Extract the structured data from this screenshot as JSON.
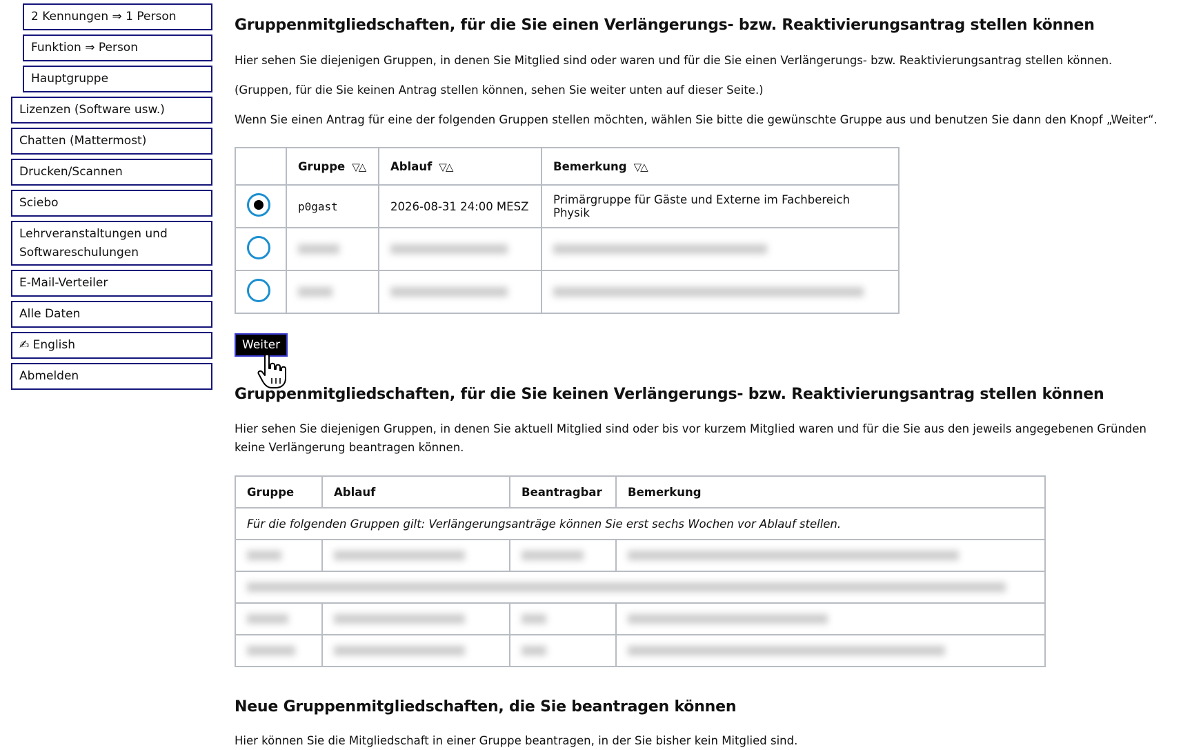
{
  "sidebar": {
    "sub_items": [
      {
        "label": "2 Kennungen ⇒ 1 Person"
      },
      {
        "label": "Funktion ⇒ Person"
      },
      {
        "label": "Hauptgruppe"
      }
    ],
    "items": [
      {
        "label": "Lizenzen (Software usw.)"
      },
      {
        "label": "Chatten (Mattermost)"
      },
      {
        "label": "Drucken/Scannen"
      },
      {
        "label": "Sciebo"
      },
      {
        "label": "Lehrveranstaltungen und Softwareschulungen"
      },
      {
        "label": "E-Mail-Verteiler"
      },
      {
        "label": "Alle Daten"
      },
      {
        "label": "✍ English"
      },
      {
        "label": "Abmelden"
      }
    ]
  },
  "section1": {
    "heading": "Gruppenmitgliedschaften, für die Sie einen Verlängerungs- bzw. Reaktivierungsantrag stellen können",
    "para1": "Hier sehen Sie diejenigen Gruppen, in denen Sie Mitglied sind oder waren und für die Sie einen Verlängerungs- bzw. Reaktivierungsantrag stellen können.",
    "para2": "(Gruppen, für die Sie keinen Antrag stellen können, sehen Sie weiter unten auf dieser Seite.)",
    "para3": "Wenn Sie einen Antrag für eine der folgenden Gruppen stellen möchten, wählen Sie bitte die gewünschte Gruppe aus und benutzen Sie dann den Knopf „Weiter“.",
    "table": {
      "headers": {
        "gruppe": "Gruppe",
        "ablauf": "Ablauf",
        "bemerkung": "Bemerkung",
        "sort_icon": "▽△"
      },
      "rows": [
        {
          "gruppe": "p0gast",
          "ablauf": "2026-08-31 24:00 MESZ",
          "bemerkung": "Primärgruppe für Gäste und Externe im Fachbereich Physik",
          "selected": true
        }
      ]
    },
    "button": "Weiter"
  },
  "section2": {
    "heading": "Gruppenmitgliedschaften, für die Sie keinen Verlängerungs- bzw. Reaktivierungsantrag stellen können",
    "para1": "Hier sehen Sie diejenigen Gruppen, in denen Sie aktuell Mitglied sind oder bis vor kurzem Mitglied waren und für die Sie aus den jeweils angegebenen Gründen keine Verlängerung beantragen können.",
    "table": {
      "headers": {
        "gruppe": "Gruppe",
        "ablauf": "Ablauf",
        "beantragbar": "Beantragbar",
        "bemerkung": "Bemerkung"
      },
      "note": "Für die folgenden Gruppen gilt: Verlängerungsanträge können Sie erst sechs Wochen vor Ablauf stellen."
    }
  },
  "section3": {
    "heading": "Neue Gruppenmitgliedschaften, die Sie beantragen können",
    "para1": "Hier können Sie die Mitgliedschaft in einer Gruppe beantragen, in der Sie bisher kein Mitglied sind."
  }
}
